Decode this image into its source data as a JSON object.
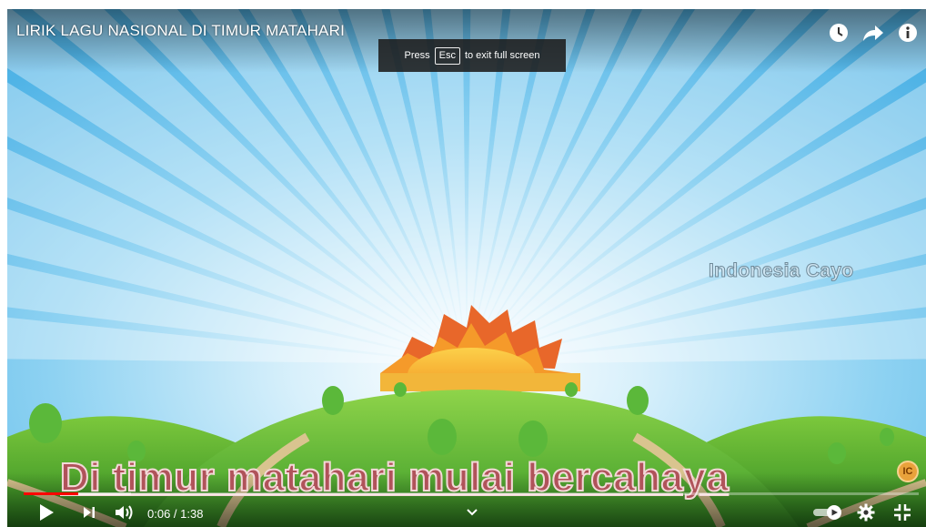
{
  "player": {
    "title": "LIRIK LAGU NASIONAL DI TIMUR MATAHARI",
    "fullscreen_toast": {
      "prefix": "Press",
      "key": "Esc",
      "suffix": "to exit full screen"
    },
    "watermark": "Indonesia Cayo",
    "lyric": "Di timur matahari mulai bercahaya",
    "channel_badge": "IC",
    "time": {
      "current": "0:06",
      "separator": " / ",
      "duration": "1:38"
    },
    "progress": {
      "played_fraction": 0.061,
      "buffered_fraction": 0.12
    },
    "top_icons": [
      "watch-later-icon",
      "share-icon",
      "info-icon"
    ],
    "control_icons": [
      "play-icon",
      "next-icon",
      "volume-icon",
      "chevron-down-icon",
      "autoplay-toggle-icon",
      "settings-gear-icon",
      "exit-fullscreen-icon"
    ],
    "colors": {
      "progress": "#ff0000",
      "sky": "#6fc3ec",
      "sun": "#f6a623",
      "hill": "#4fae2e",
      "lyric_fill": "#b0535a"
    }
  }
}
